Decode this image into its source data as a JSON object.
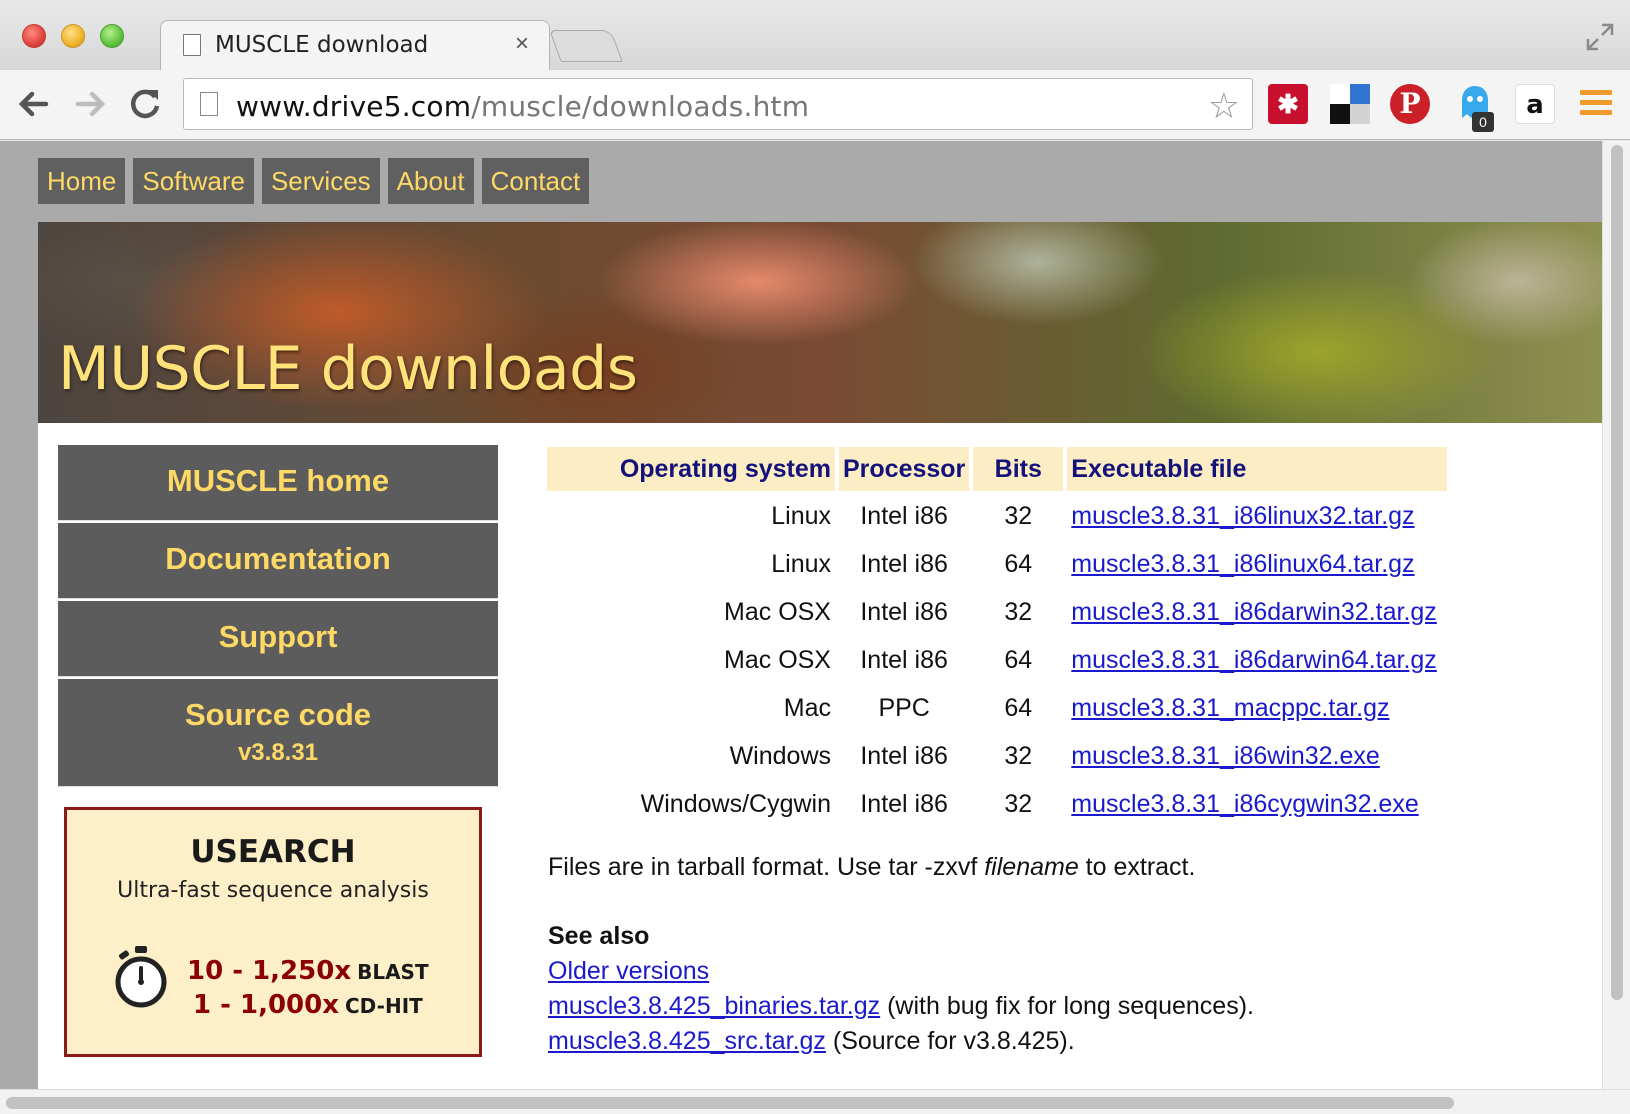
{
  "browser": {
    "tab_title": "MUSCLE download",
    "tab_close": "×",
    "url_host": "www.drive5.com",
    "url_path": "/muscle/downloads.htm",
    "ghostery_count": "0",
    "amazon_label": "a"
  },
  "topnav": {
    "items": [
      "Home",
      "Software",
      "Services",
      "About",
      "Contact"
    ]
  },
  "banner": {
    "title": "MUSCLE downloads"
  },
  "sidemenu": {
    "items": [
      "MUSCLE home",
      "Documentation",
      "Support"
    ],
    "source_code": {
      "label": "Source code",
      "version": "v3.8.31"
    }
  },
  "usearch_ad": {
    "title": "USEARCH",
    "subtitle": "Ultra-fast sequence analysis",
    "row1_speed": "10 - 1,250x",
    "row1_tool": "BLAST",
    "row2_speed": "1 - 1,000x",
    "row2_tool": "CD-HIT"
  },
  "downloads": {
    "headers": [
      "Operating system",
      "Processor",
      "Bits",
      "Executable file"
    ],
    "rows": [
      {
        "os": "Linux",
        "processor": "Intel i86",
        "bits": "32",
        "file": "muscle3.8.31_i86linux32.tar.gz"
      },
      {
        "os": "Linux",
        "processor": "Intel i86",
        "bits": "64",
        "file": "muscle3.8.31_i86linux64.tar.gz"
      },
      {
        "os": "Mac OSX",
        "processor": "Intel i86",
        "bits": "32",
        "file": "muscle3.8.31_i86darwin32.tar.gz"
      },
      {
        "os": "Mac OSX",
        "processor": "Intel i86",
        "bits": "64",
        "file": "muscle3.8.31_i86darwin64.tar.gz"
      },
      {
        "os": "Mac",
        "processor": "PPC",
        "bits": "64",
        "file": "muscle3.8.31_macppc.tar.gz"
      },
      {
        "os": "Windows",
        "processor": "Intel i86",
        "bits": "32",
        "file": "muscle3.8.31_i86win32.exe"
      },
      {
        "os": "Windows/Cygwin",
        "processor": "Intel i86",
        "bits": "32",
        "file": "muscle3.8.31_i86cygwin32.exe"
      }
    ]
  },
  "note": {
    "before": "Files are in tarball format. Use tar -zxvf ",
    "emphasis": "filename",
    "after": " to extract."
  },
  "see_also": {
    "title": "See also",
    "older_versions": "Older versions",
    "binaries_link": "muscle3.8.425_binaries.tar.gz",
    "binaries_note": " (with bug fix for long sequences).",
    "src_link": "muscle3.8.425_src.tar.gz",
    "src_note": " (Source for v3.8.425)."
  },
  "colors": {
    "nav_bg": "#606060",
    "nav_text": "#ffd966",
    "header_bg": "#fdedc4",
    "header_text": "#12127a",
    "link": "#1a1acc",
    "ad_border": "#8b1a1a"
  }
}
